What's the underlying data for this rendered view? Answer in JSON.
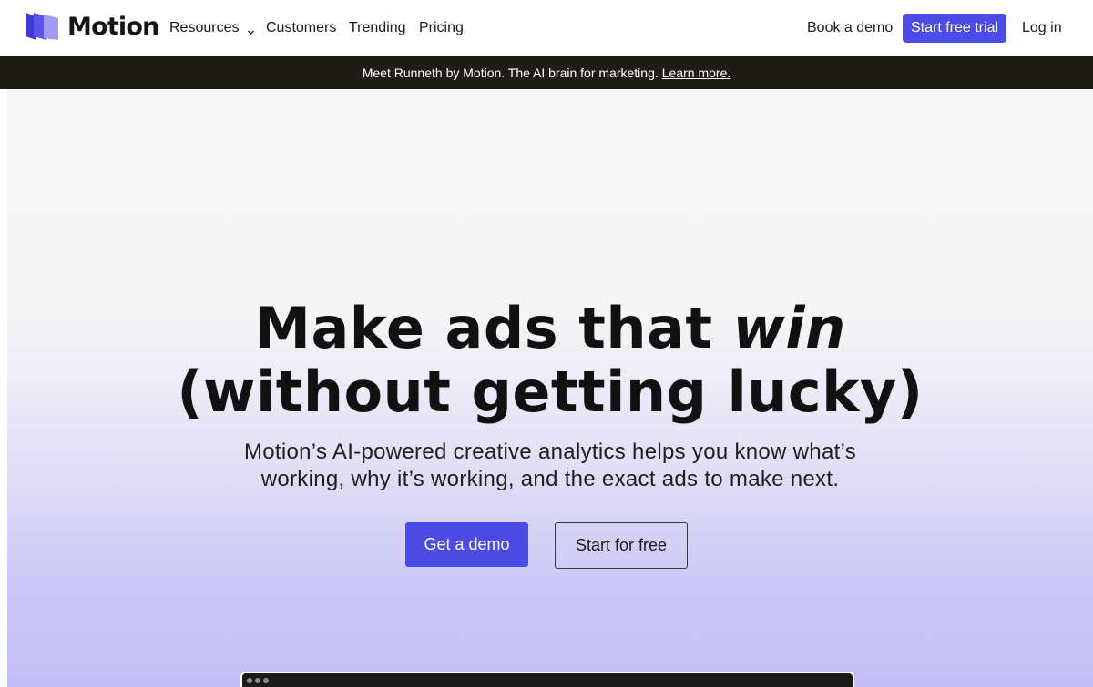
{
  "brand": {
    "name": "Motion",
    "accent": "#4b4be6",
    "logo_icon": "motion-stacked-cards-logo"
  },
  "nav": {
    "resources": "Resources",
    "customers": "Customers",
    "trending": "Trending",
    "pricing": "Pricing",
    "book_demo": "Book a demo",
    "start_trial": "Start free trial",
    "login": "Log in"
  },
  "announcement": {
    "text": "Meet Runneth by Motion. The AI brain for marketing.",
    "link": "Learn more."
  },
  "hero": {
    "title_line1_plain": "Make ads that ",
    "title_line1_em": "win",
    "title_line2": "(without getting lucky)",
    "subtitle_line1": "Motion’s AI-powered creative analytics helps you know what’s",
    "subtitle_line2": "working, why it’s working, and the exact ads to make next.",
    "primary_cta": "Get a demo",
    "secondary_cta": "Start for free"
  }
}
